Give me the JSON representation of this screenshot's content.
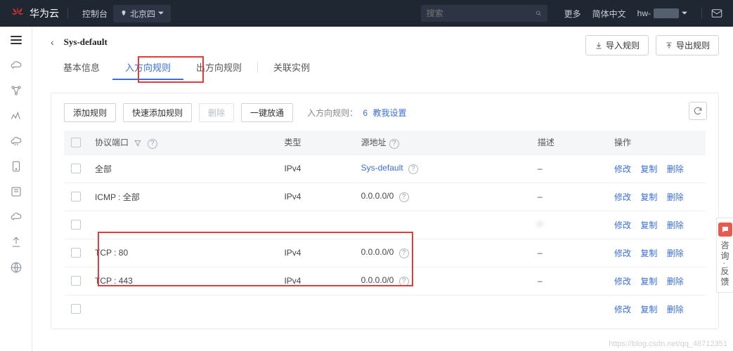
{
  "topbar": {
    "brand": "华为云",
    "console": "控制台",
    "region": "北京四",
    "search_placeholder": "搜索",
    "more": "更多",
    "lang": "简体中文",
    "user_prefix": "hw-"
  },
  "page": {
    "title": "Sys-default",
    "buttons": {
      "import": "导入规则",
      "export": "导出规则"
    }
  },
  "tabs": [
    "基本信息",
    "入方向规则",
    "出方向规则",
    "关联实例"
  ],
  "active_tab": 1,
  "toolbar": {
    "add": "添加规则",
    "quick_add": "快速添加规则",
    "delete": "删除",
    "one_click": "一键放通",
    "count_label": "入方向规则：",
    "count": "6",
    "custom_link": "教我设置"
  },
  "columns": {
    "protocol": "协议端口",
    "type": "类型",
    "source": "源地址",
    "desc": "描述",
    "ops": "操作"
  },
  "rows": [
    {
      "protocol": "全部",
      "type": "IPv4",
      "source": "Sys-default",
      "source_link": true,
      "desc": "–"
    },
    {
      "protocol": "ICMP : 全部",
      "type": "IPv4",
      "source": "0.0.0.0/0",
      "desc": "–"
    },
    {
      "protocol": " ",
      "type": " ",
      "source": " ",
      "desc": "P",
      "blurred": true
    },
    {
      "protocol": "TCP : 80",
      "type": "IPv4",
      "source": "0.0.0.0/0",
      "desc": "–"
    },
    {
      "protocol": "TCP : 443",
      "type": "IPv4",
      "source": "0.0.0.0/0",
      "desc": "–"
    },
    {
      "protocol": " ",
      "type": " ",
      "source": " ",
      "desc": " ",
      "blurred": true
    }
  ],
  "ops": {
    "modify": "修改",
    "copy": "复制",
    "delete": "删除"
  },
  "feedback": "咨询·反馈",
  "watermark": "https://blog.csdn.net/qq_48712351"
}
